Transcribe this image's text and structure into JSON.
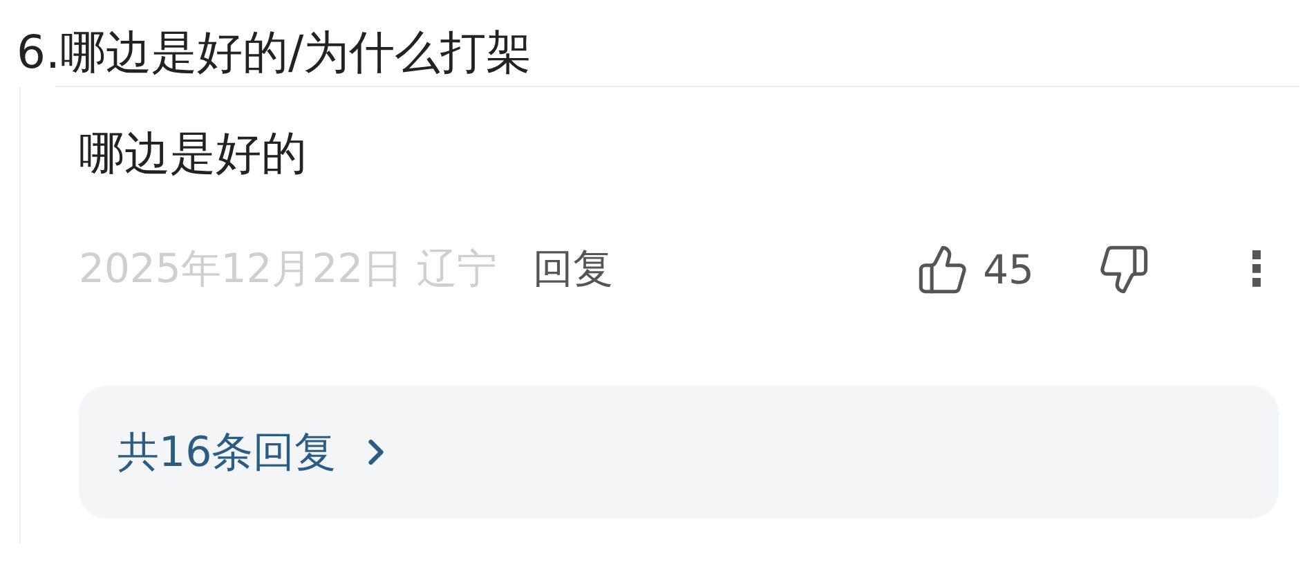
{
  "heading": "6.哪边是好的/为什么打架",
  "comment": {
    "text": "哪边是好的",
    "date": "2025年12月22日",
    "location": "辽宁",
    "reply_label": "回复",
    "likes": "45",
    "more": "⋮"
  },
  "replies_link": {
    "label": "共16条回复"
  }
}
